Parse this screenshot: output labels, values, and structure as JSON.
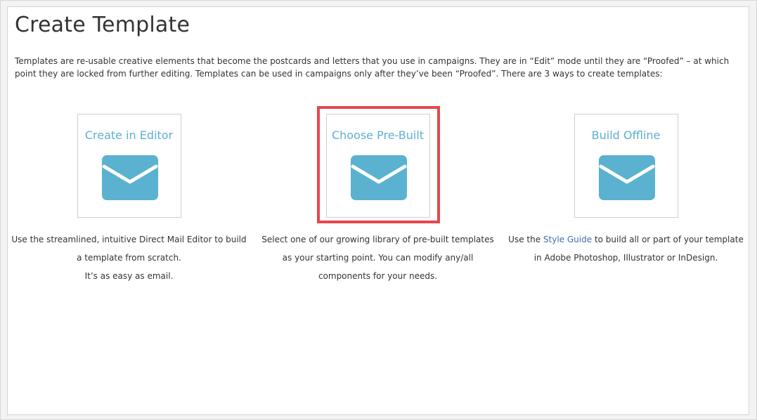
{
  "page": {
    "title": "Create Template",
    "intro": "Templates are re-usable creative elements that become the postcards and letters that you use in campaigns. They are in “Edit” mode until they are “Proofed” – at which point they are locked from further editing. Templates can be used in campaigns only after they’ve been “Proofed”. There are 3 ways to create templates:"
  },
  "options": [
    {
      "title": "Create in Editor",
      "icon": "envelope-icon",
      "desc_lines": [
        "Use the streamlined, intuitive Direct Mail Editor to build",
        "a template from scratch.",
        "It’s as easy as email."
      ]
    },
    {
      "title": "Choose Pre-Built",
      "icon": "envelope-icon",
      "highlighted": true,
      "desc_lines": [
        "Select one of our growing library of pre-built templates",
        "as your starting point. You can modify any/all",
        "components for your needs."
      ]
    },
    {
      "title": "Build Offline",
      "icon": "envelope-icon",
      "desc_prefix": "Use the ",
      "desc_link": "Style Guide",
      "desc_suffix": " to build all or part of your template",
      "desc_line2": "in Adobe Photoshop, Illustrator or InDesign."
    }
  ],
  "colors": {
    "accent": "#5bb1d0",
    "highlight": "#e8464c",
    "link": "#3d6fa8",
    "text": "#333333"
  }
}
